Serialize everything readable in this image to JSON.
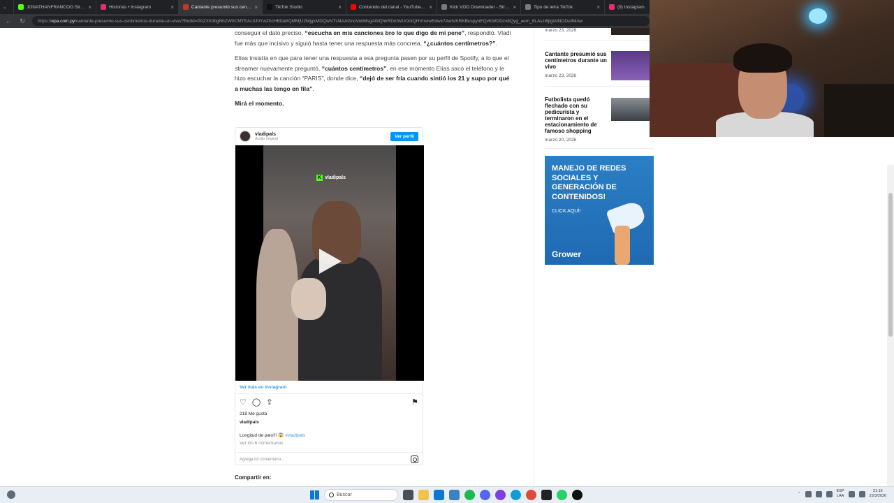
{
  "browser": {
    "tabs": [
      {
        "label": "JONATHANFRANCOO Stream - W",
        "color": "#53fc18",
        "active": false
      },
      {
        "label": "Historias • Instagram",
        "color": "#e1306c",
        "active": false
      },
      {
        "label": "Cantante presumió sus centímetros",
        "color": "#c0392b",
        "active": true
      },
      {
        "label": "TikTok Studio",
        "color": "#111111",
        "active": false
      },
      {
        "label": "Contenido del canal - YouTube St",
        "color": "#ff0000",
        "active": false
      },
      {
        "label": "Kick VOD Downloader - Streams o",
        "color": "#7a7a7a",
        "active": false
      },
      {
        "label": "Tipo de letra TikTok",
        "color": "#7a7a7a",
        "active": false
      },
      {
        "label": "(9) Instagram",
        "color": "#e1306c",
        "active": false
      }
    ],
    "url_host": "epa.com.py",
    "url_prefix": "https://",
    "url_path": "/cantante-presumio-sus-centimetros-durante-un-vivo/?fbclid=PAZXh0bgNhZW0CMTEAc3J0YwZhcHBfaWQMMjU2MjgxMDQwNTU4AAGnoVoiiMsgAWQhkRDntWUOntQHVnsIwEdwx7AwiVKRKBuspynEQvKWDDzv8Qyg_aem_8LAszi8jlgiAINDDu9f4Aw"
  },
  "article": {
    "p1_pre": "conseguir el dato preciso, ",
    "p1_bold": "“escucha en mis canciones bro lo que digo de mi pene”",
    "p1_post": ", respondió. Vladi fue más que incisivo y siguió hasta tener una respuesta más concreta, ",
    "p1_bold2": "“¿cuántos centímetros?”",
    "p1_end": ".",
    "p2_pre": "Elías insistía en que para tener una respuesta a esa pregunta pasen por su perfil de Spotify, a lo que el streamer nuevamente preguntó, ",
    "p2_bold": "“cuántos centímetros”",
    "p2_mid": ", en ese momento Elías sacó el teléfono y le hizo escuchar la canción “PARIS”, donde dice, ",
    "p2_bold2": "“dejó de ser fría cuando sintió los 21 y supo por qué a muchas las tengo en fila”",
    "p2_end": ".",
    "p3": "Mirá el momento.",
    "share": "Compartir en:"
  },
  "instagram": {
    "username": "vladipals",
    "audio": "Audio original",
    "view_profile": "Ver perfil",
    "watermark": "vladipals",
    "see_more": "Ver más en Instagram",
    "likes": "218 Me gusta",
    "caption_user": "vladipals",
    "caption_text": "Longitud de palo!!! 😱 ",
    "caption_tag": "#vladipals",
    "comments": "Ver los 6 comentarios",
    "add_comment": "Agrega un comentario..."
  },
  "sidebar": {
    "news": [
      {
        "title": "",
        "date": "marzo 23, 2026"
      },
      {
        "title": "Cantante presumió sus centímetros durante un vivo",
        "date": "marzo 23, 2026"
      },
      {
        "title": "Futbolista quedó flechado con su pedicurista y terminaron en el estacionamiento de famoso shopping",
        "date": "marzo 20, 2026"
      }
    ]
  },
  "ad": {
    "headline": "MANEJO DE REDES SOCIALES Y GENERACIÓN DE CONTENIDOS!",
    "cta": "CLICK AQUÍ!",
    "brand": "Grower"
  },
  "taskbar": {
    "search": "Buscar",
    "lang1": "ESP",
    "lang2": "LAA",
    "time": "21:16",
    "date": "23/3/2026"
  },
  "colors": {
    "instagram_blue": "#0095f6",
    "kick_green": "#53fc18",
    "ad_blue": "#2b7fc4"
  }
}
